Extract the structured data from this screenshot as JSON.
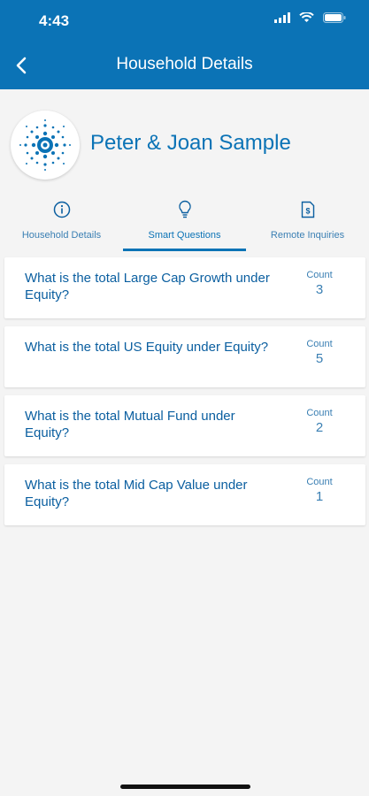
{
  "status_bar": {
    "time": "4:43"
  },
  "nav": {
    "title": "Household Details"
  },
  "profile": {
    "name": "Peter & Joan Sample"
  },
  "tabs": [
    {
      "label": "Household Details",
      "icon": "info-icon"
    },
    {
      "label": "Smart Questions",
      "icon": "lightbulb-icon",
      "active": true
    },
    {
      "label": "Remote Inquiries",
      "icon": "dollar-document-icon"
    }
  ],
  "questions": [
    {
      "text": "What is the total Large Cap Growth under Equity?",
      "count_label": "Count",
      "count": "3"
    },
    {
      "text": "What is the total US Equity under Equity?",
      "count_label": "Count",
      "count": "5"
    },
    {
      "text": "What is the total Mutual Fund under Equity?",
      "count_label": "Count",
      "count": "2"
    },
    {
      "text": "What is the total Mid Cap Value under Equity?",
      "count_label": "Count",
      "count": "1"
    }
  ],
  "colors": {
    "brand": "#0b73b6",
    "background": "#f4f4f4"
  }
}
